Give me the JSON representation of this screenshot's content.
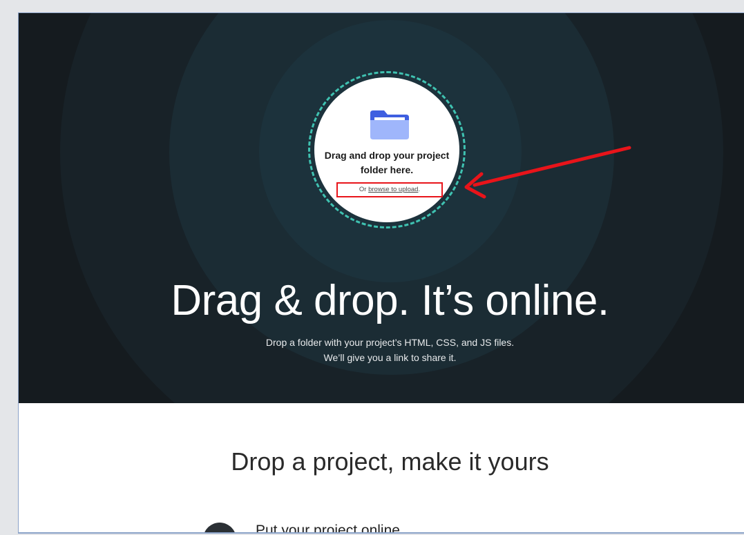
{
  "dropzone": {
    "icon": "folder-icon",
    "title_line1": "Drag and drop your project",
    "title_line2": "folder here.",
    "sub_prefix": "Or ",
    "sub_link": "browse to upload",
    "sub_suffix": "."
  },
  "hero": {
    "headline": "Drag & drop. It’s online.",
    "tagline_line1": "Drop a folder with your project’s HTML, CSS, and JS files.",
    "tagline_line2": "We’ll give you a link to share it."
  },
  "section": {
    "title": "Drop a project, make it yours",
    "steps": [
      {
        "title": "Put your project online"
      }
    ]
  },
  "annotation": {
    "color": "#e8141a"
  },
  "colors": {
    "hero_bg": "#151b1f",
    "dash_accent": "#3fc2b1",
    "folder": "#4f6ee8"
  }
}
